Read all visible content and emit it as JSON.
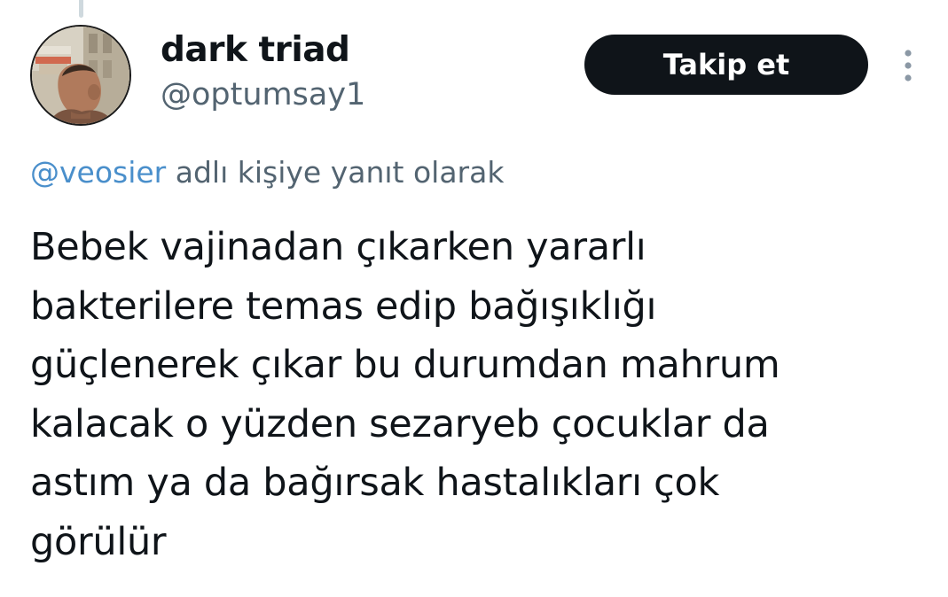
{
  "tweet": {
    "author": {
      "display_name": "dark triad",
      "handle": "@optumsay1",
      "avatar_icon": "profile-photo"
    },
    "follow_button_label": "Takip et",
    "more_icon": "more-vertical-icon",
    "reply_context": {
      "mention": "@veosier",
      "suffix": " adlı kişiye yanıt olarak"
    },
    "text_lines": [
      "Bebek vajinadan çıkarken yararlı",
      "bakterilere temas edip bağışıklığı",
      "güçlenerek çıkar bu durumdan mahrum",
      "kalacak o yüzden sezaryeb çocuklar da",
      "astım ya da bağırsak hastalıkları çok",
      "görülür"
    ]
  },
  "colors": {
    "text_primary": "#0f1419",
    "text_secondary": "#536471",
    "mention": "#4a8fcb",
    "follow_button_bg": "#0f1419",
    "follow_button_text": "#ffffff"
  }
}
